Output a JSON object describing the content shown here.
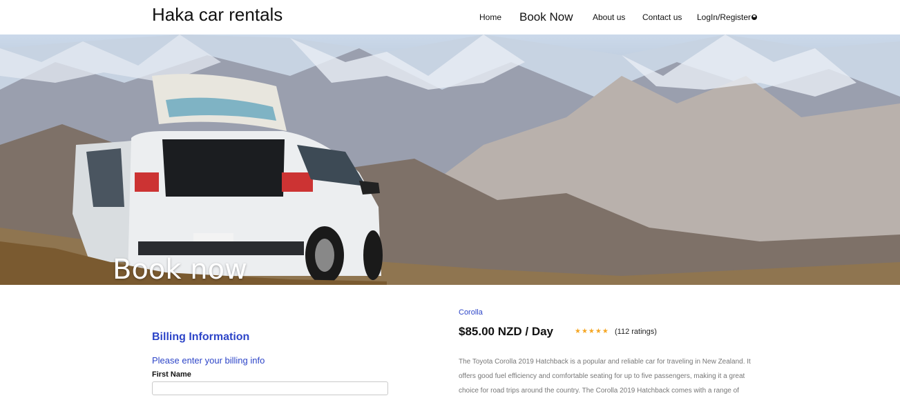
{
  "header": {
    "brand": "Haka car rentals",
    "nav": {
      "home": "Home",
      "book_now": "Book Now",
      "about": "About us",
      "contact": "Contact us",
      "login": "LogIn/Register"
    }
  },
  "hero": {
    "title": "Book now"
  },
  "billing": {
    "title": "Billing Information",
    "subtitle": "Please enter your billing info",
    "first_name_label": "First Name",
    "first_name_value": ""
  },
  "product": {
    "car_name": "Corolla",
    "price": "$85.00 NZD / Day",
    "stars": "★★★★★",
    "rating_value": 5,
    "ratings_text": "(112 ratings)",
    "description": "The Toyota Corolla 2019 Hatchback is a popular and reliable car for traveling in New Zealand. It offers good fuel efficiency and comfortable seating for up to five passengers, making it a great choice for road trips around the country. The Corolla 2019 Hatchback comes with a range of"
  },
  "colors": {
    "accent": "#2d45c8",
    "star": "#f5a623"
  }
}
